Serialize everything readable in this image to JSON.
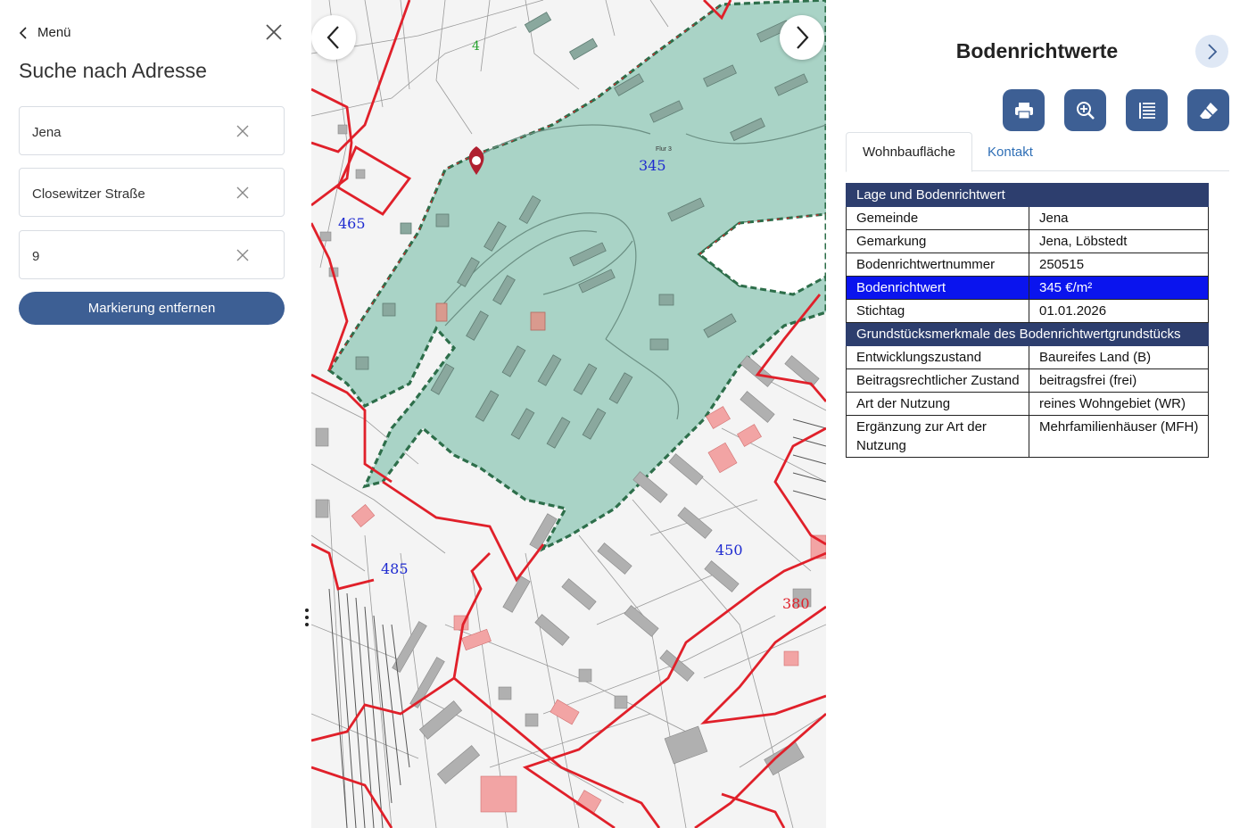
{
  "sidebar": {
    "back_label": "Menü",
    "title": "Suche nach Adresse",
    "fields": [
      {
        "value": "Jena"
      },
      {
        "value": "Closewitzer Straße"
      },
      {
        "value": "9"
      }
    ],
    "remove_button": "Markierung entfernen"
  },
  "map": {
    "zone_labels": {
      "z345": "345",
      "z465": "465",
      "z485": "485",
      "z450": "450",
      "z380": "380",
      "z4": "4",
      "flur": "Flur 3"
    },
    "colors": {
      "zone_fill": "#a9d3c6",
      "zone_border_green": "#2d6e4a",
      "zone_border_red": "#e0202a",
      "building": "#b0b0b0",
      "building_highlight": "#f2a4a4",
      "marker": "#b02030"
    }
  },
  "panel": {
    "title": "Bodenrichtwerte",
    "tools": [
      "printer-icon",
      "zoom-in-icon",
      "list-icon",
      "eraser-icon"
    ],
    "tabs": [
      {
        "label": "Wohnbaufläche",
        "active": true
      },
      {
        "label": "Kontakt",
        "active": false
      }
    ],
    "section1_header": "Lage und Bodenrichtwert",
    "rows1": [
      {
        "key": "Gemeinde",
        "value": "Jena"
      },
      {
        "key": "Gemarkung",
        "value": "Jena, Löbstedt"
      },
      {
        "key": "Bodenrichtwertnummer",
        "value": "250515"
      },
      {
        "key": "Bodenrichtwert",
        "value": "345 €/m²"
      },
      {
        "key": "Stichtag",
        "value": "01.01.2026"
      }
    ],
    "section2_header": "Grundstücksmerkmale des Bodenrichtwertgrundstücks",
    "rows2": [
      {
        "key": "Entwicklungszustand",
        "value": "Baureifes Land (B)"
      },
      {
        "key": "Beitragsrechtlicher Zustand",
        "value": "beitragsfrei (frei)"
      },
      {
        "key": "Art der Nutzung",
        "value": "reines Wohngebiet (WR)"
      },
      {
        "key": "Ergänzung zur Art der Nutzung",
        "value": "Mehrfamilienhäuser (MFH)"
      }
    ],
    "colors": {
      "header_bg": "#2d3e6e",
      "highlight_bg": "#0a14ee",
      "tool_bg": "#3d5f94"
    }
  }
}
